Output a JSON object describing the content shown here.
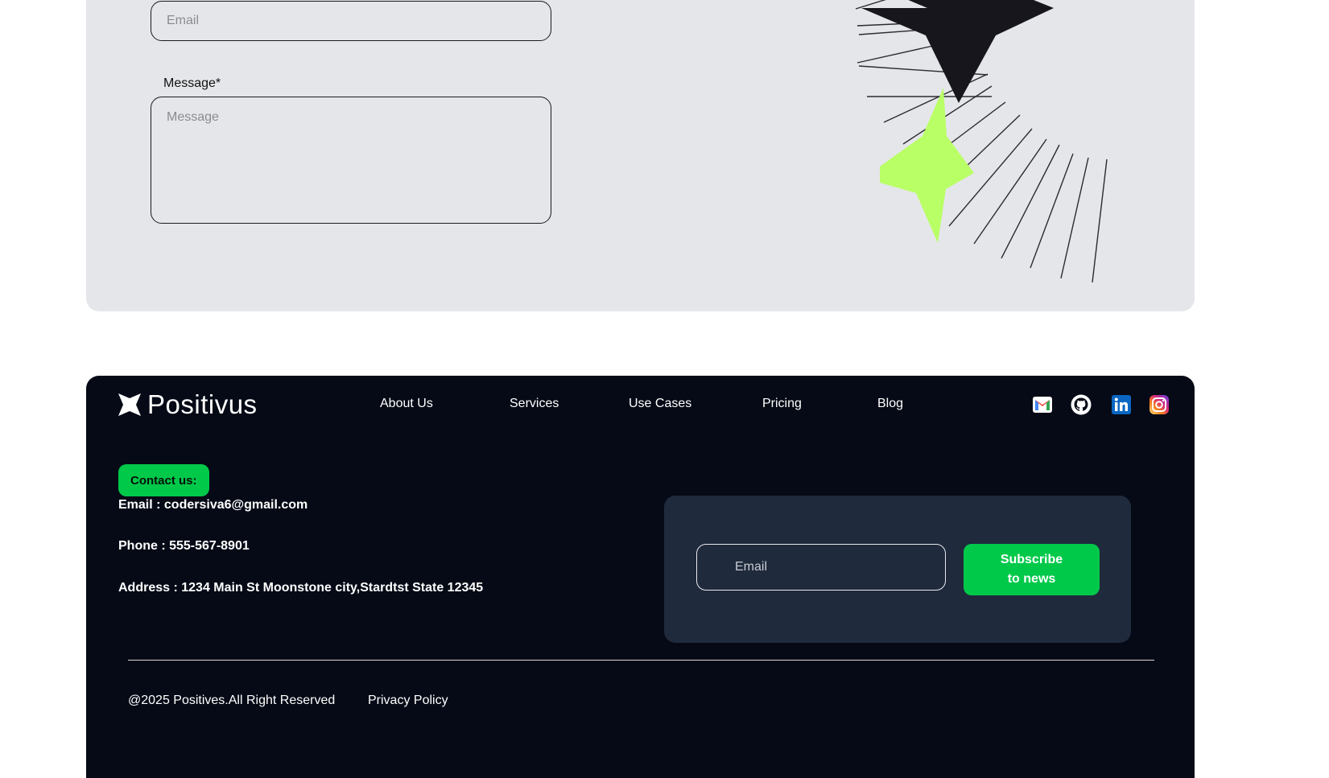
{
  "contact_form": {
    "email_placeholder": "Email",
    "message_label": "Message*",
    "message_placeholder": "Message"
  },
  "footer": {
    "logo_text": "Positivus",
    "nav": [
      "About Us",
      "Services",
      "Use Cases",
      "Pricing",
      "Blog"
    ],
    "social_icons": [
      "gmail-icon",
      "github-icon",
      "linkedin-icon",
      "instagram-icon"
    ],
    "contact_badge": "Contact us:",
    "email": "Email : codersiva6@gmail.com",
    "phone": "Phone : 555-567-8901",
    "address": "Address : 1234 Main St Moonstone city,Stardtst State 12345",
    "subscribe": {
      "email_placeholder": "Email",
      "button_line1": "Subscribe",
      "button_line2": "to news"
    },
    "copyright": "@2025 Positives.All Right Reserved",
    "privacy": "Privacy Policy"
  },
  "colors": {
    "accent_green": "#00c94a",
    "lime_star": "#b9ff66",
    "footer_bg": "#050a16",
    "card_bg": "#e5e6ea",
    "subscribe_bg": "#1f2a3c"
  }
}
